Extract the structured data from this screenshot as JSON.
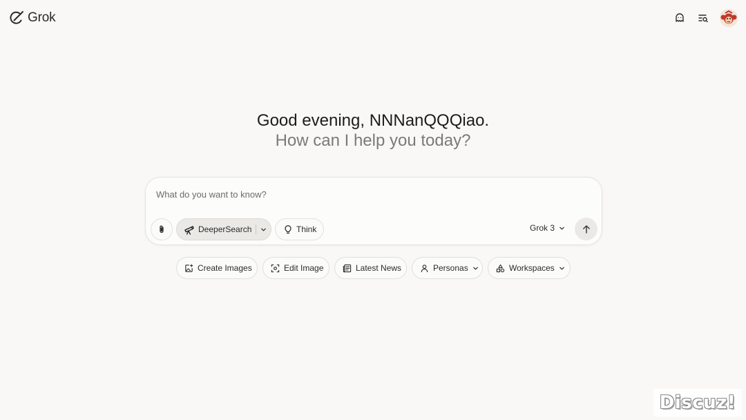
{
  "header": {
    "logo_text": "Grok",
    "icons": [
      "ghost-icon",
      "search-history-icon",
      "avatar"
    ]
  },
  "greeting": {
    "line1": "Good evening, NNNanQQQiao.",
    "line2": "How can I help you today?"
  },
  "composer": {
    "placeholder": "What do you want to know?",
    "attach_icon": "paperclip-icon",
    "deeper_search_label": "DeeperSearch",
    "think_label": "Think",
    "model_label": "Grok 3",
    "send_icon": "arrow-up-icon"
  },
  "chips": {
    "create_images": "Create Images",
    "edit_image": "Edit Image",
    "latest_news": "Latest News",
    "personas": "Personas",
    "workspaces": "Workspaces"
  },
  "watermark": {
    "text": "Discuz!"
  },
  "colors": {
    "background": "#f9f8f6",
    "composer_bg": "#fcfcfb",
    "border": "#e4e2de",
    "active_pill": "#ebe9e6",
    "muted_text": "#7a7a7a"
  }
}
